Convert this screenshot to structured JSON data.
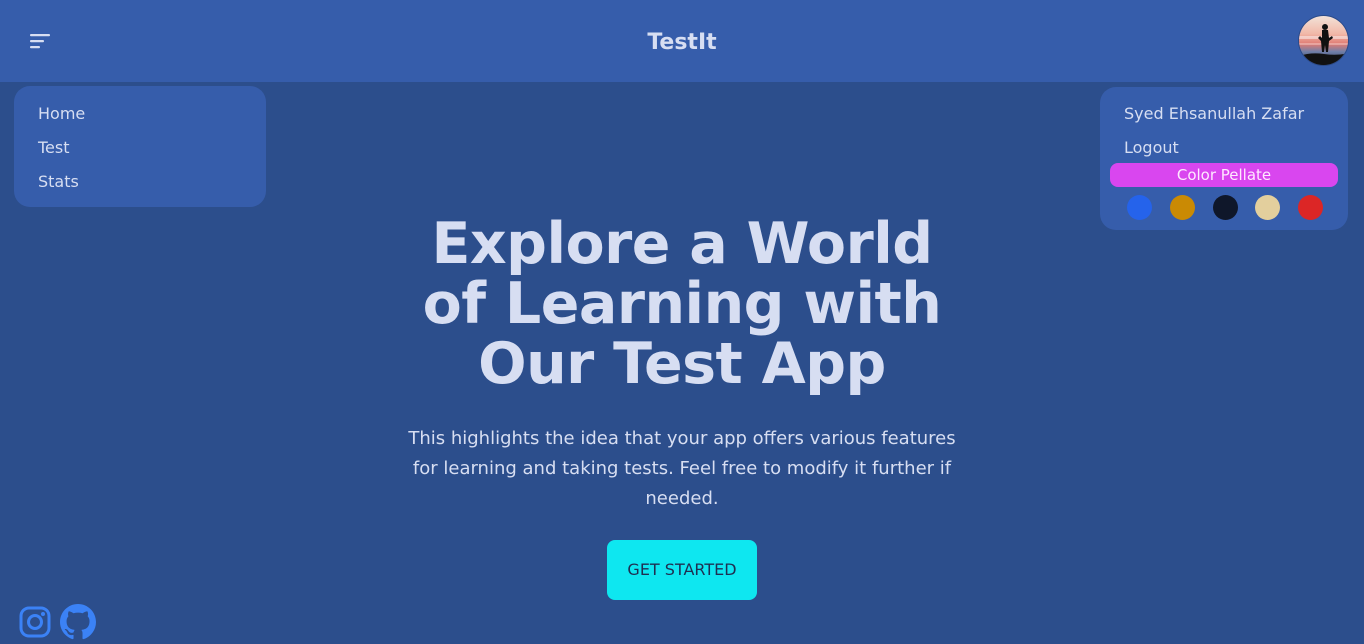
{
  "header": {
    "title": "TestIt",
    "menu_icon": "hamburger-menu-icon",
    "avatar_icon": "avatar-image"
  },
  "nav_menu": {
    "items": [
      {
        "label": "Home"
      },
      {
        "label": "Test"
      },
      {
        "label": "Stats"
      }
    ]
  },
  "profile_menu": {
    "user_name": "Syed Ehsanullah Zafar",
    "logout_label": "Logout",
    "palette_label": "Color Pellate",
    "swatches": [
      "#2563eb",
      "#ca8a04",
      "#0f172a",
      "#e3cf9d",
      "#dc2626"
    ]
  },
  "hero": {
    "title": "Explore a World of Learning with Our Test App",
    "description": "This highlights the idea that your app offers various features for learning and taking tests. Feel free to modify it further if needed.",
    "cta_label": "GET STARTED"
  },
  "footer": {
    "social_icons": [
      "instagram-icon",
      "github-icon"
    ]
  },
  "colors": {
    "background": "#2c4e8c",
    "surface": "#365dab",
    "text": "#d7def2",
    "accent": "#0ee7f0",
    "palette_label_bg": "#d946ef"
  }
}
